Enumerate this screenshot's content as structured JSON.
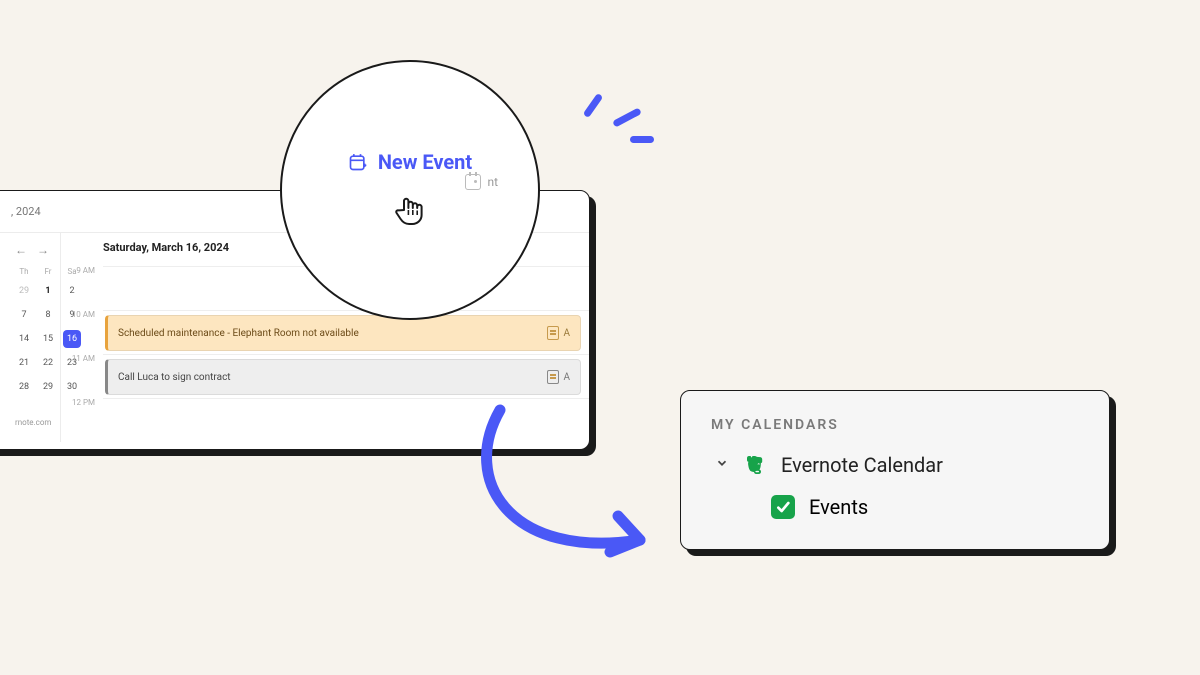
{
  "calendar": {
    "year_label": ", 2024",
    "nav": {
      "prev": "←",
      "next": "→"
    },
    "dow": [
      "Th",
      "Fr",
      "Sa"
    ],
    "weeks": [
      [
        {
          "n": "29",
          "dim": true
        },
        {
          "n": "1",
          "bold": true
        },
        {
          "n": "2"
        }
      ],
      [
        {
          "n": "7"
        },
        {
          "n": "8"
        },
        {
          "n": "9"
        }
      ],
      [
        {
          "n": "14"
        },
        {
          "n": "15"
        },
        {
          "n": "16",
          "sel": true
        }
      ],
      [
        {
          "n": "21"
        },
        {
          "n": "22"
        },
        {
          "n": "23"
        }
      ],
      [
        {
          "n": "28"
        },
        {
          "n": "29"
        },
        {
          "n": "30"
        }
      ]
    ],
    "footer_text": "rnote.com",
    "day_title": "Saturday, March 16, 2024",
    "hours": [
      "9 AM",
      "10 AM",
      "11 AM",
      "12 PM"
    ],
    "events": [
      {
        "title": "Scheduled maintenance - Elephant Room not available",
        "variant": "orange",
        "slot": 1,
        "action": "A"
      },
      {
        "title": "Call Luca to sign contract",
        "variant": "gray",
        "slot": 3,
        "action": "A"
      }
    ]
  },
  "magnifier": {
    "label": "New Event",
    "secondary": "nt"
  },
  "mycal": {
    "heading": "MY CALENDARS",
    "group": "Evernote Calendar",
    "item": "Events"
  },
  "colors": {
    "accent": "#4a58f6",
    "green": "#17a34a"
  }
}
